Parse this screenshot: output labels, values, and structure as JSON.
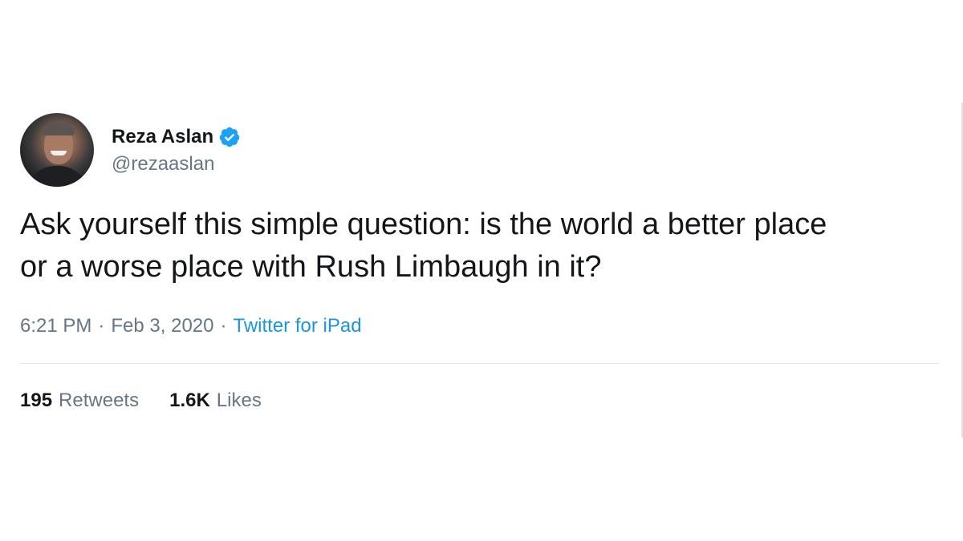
{
  "tweet": {
    "display_name": "Reza Aslan",
    "handle": "@rezaaslan",
    "verified": true,
    "text_line_1": "Ask yourself this simple question: is the world a better place",
    "text_line_2": "or a worse place with Rush Limbaugh in it?",
    "time": "6:21 PM",
    "date": "Feb 3, 2020",
    "separator": "·",
    "source": "Twitter for iPad"
  },
  "stats": {
    "retweets_count": "195",
    "retweets_label": "Retweets",
    "likes_count": "1.6K",
    "likes_label": "Likes"
  },
  "colors": {
    "text_primary": "#14171a",
    "text_secondary": "#657786",
    "link": "#1b95e0",
    "verified_badge": "#1da1f2",
    "divider": "#e1e8ed"
  },
  "icons": {
    "verified": "verified-badge-icon"
  }
}
